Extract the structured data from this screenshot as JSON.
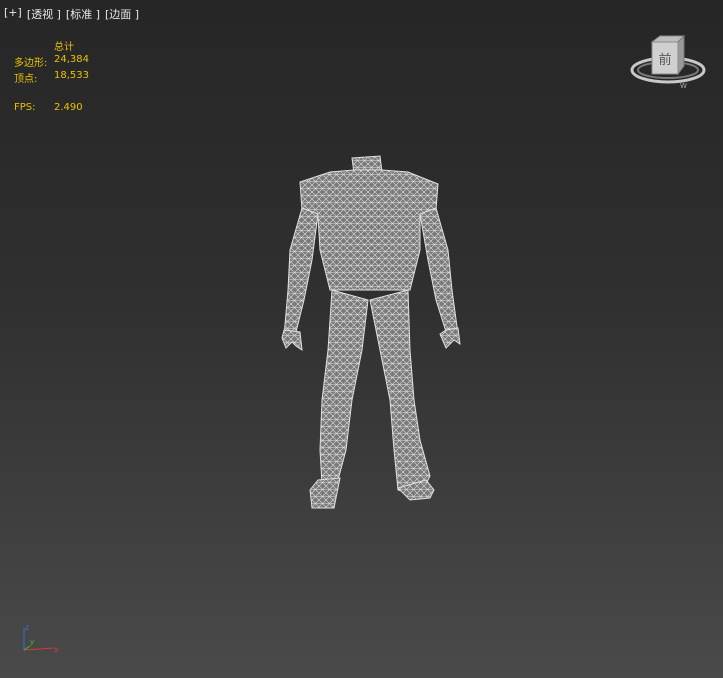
{
  "viewport": {
    "labels": [
      "[+]",
      "[透视 ]",
      "[标准 ]",
      "[边面 ]"
    ]
  },
  "stats": {
    "header": "总计",
    "polygons_label": "多边形:",
    "polygons_value": "24,384",
    "vertices_label": "顶点:",
    "vertices_value": "18,533",
    "fps_label": "FPS:",
    "fps_value": "2.490"
  },
  "viewcube": {
    "face_label": "前"
  },
  "axis": {
    "x": "x",
    "y": "y",
    "z": "z"
  },
  "colors": {
    "stats_text": "#e8c200",
    "mesh": "#d9d9d9",
    "axis_x": "#d23a3a",
    "axis_y": "#3ac23a",
    "axis_z": "#3a6ed2"
  }
}
